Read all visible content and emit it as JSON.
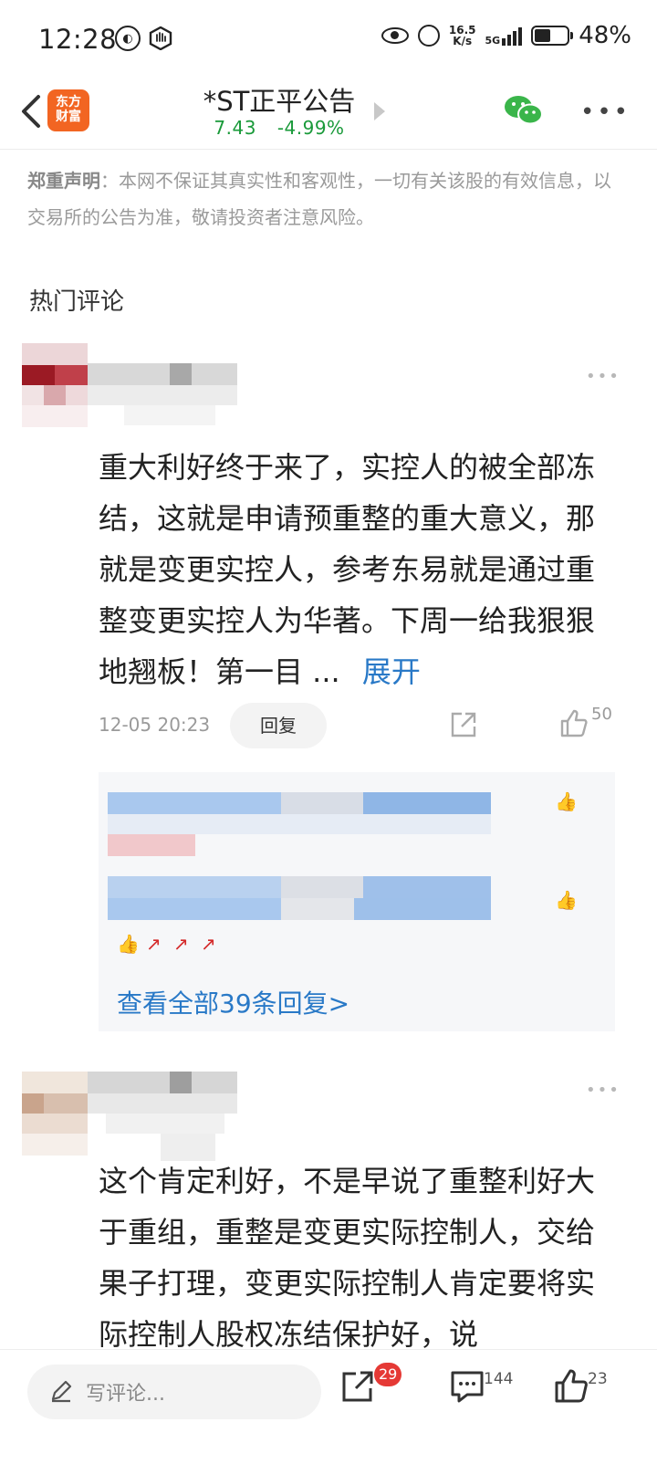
{
  "status_bar": {
    "time": "12:28",
    "net_speed_top": "16.5",
    "net_speed_bottom": "K/s",
    "network": "5G",
    "battery_pct": "48%",
    "battery_level": 0.48
  },
  "header": {
    "logo_line1": "东方",
    "logo_line2": "财富",
    "title": "*ST正平公告",
    "price": "7.43",
    "change": "-4.99%"
  },
  "disclaimer": {
    "label": "郑重声明",
    "text": "：本网不保证其真实性和客观性，一切有关该股的有效信息，以交易所的公告为准，敬请投资者注意风险。"
  },
  "section_title": "热门评论",
  "comments": [
    {
      "text": "重大利好终于来了，实控人的被全部冻结，这就是申请预重整的重大意义，那就是变更实控人，参考东易就是通过重整变更实控人为华著。下周一给我狠狠地翘板！第一目 ...",
      "expand_label": "展开",
      "time": "12-05 20:23",
      "reply_label": "回复",
      "likes": "50",
      "view_all_replies": "查看全部39条回复>"
    },
    {
      "text": "这个肯定利好，不是早说了重整利好大于重组，重整是变更实际控制人，交给果子打理，变更实际控制人肯定要将实际控制人股权冻结保护好，说"
    }
  ],
  "bottom_bar": {
    "comment_placeholder": "写评论...",
    "share_badge": "29",
    "comments_count": "144",
    "likes_count": "23"
  },
  "colors": {
    "price_green": "#1a9a3a",
    "link_blue": "#2979c7",
    "badge_red": "#e53935",
    "logo_orange": "#f26522"
  }
}
